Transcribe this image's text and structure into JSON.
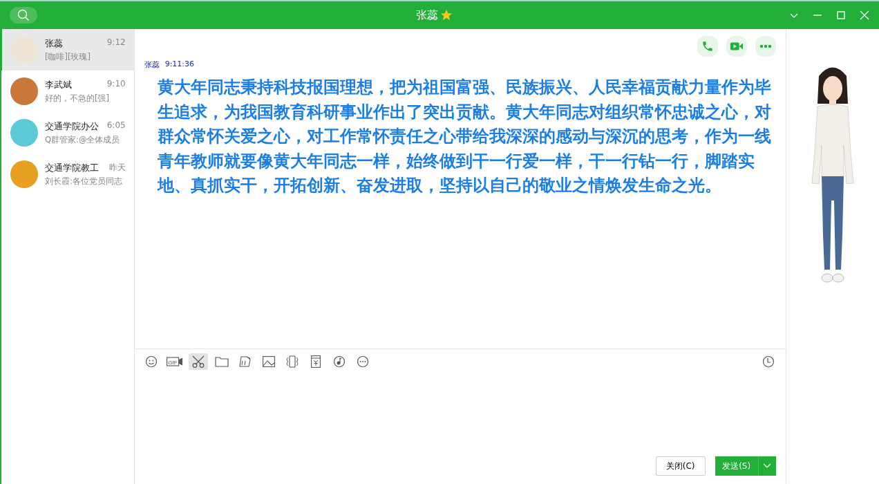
{
  "window": {
    "title": "张蕊"
  },
  "conversations": [
    {
      "name": "张蕊",
      "time": "9:12",
      "preview": "[咖啡][玫瑰]",
      "selected": true,
      "color": "#efe6d6"
    },
    {
      "name": "李武斌",
      "time": "9:10",
      "preview": "好的，不急的[强]",
      "selected": false,
      "color": "#c9773a"
    },
    {
      "name": "交通学院办公",
      "time": "6:05",
      "preview": "Q群管家:@全体成员",
      "selected": false,
      "color": "#5cc9d6"
    },
    {
      "name": "交通学院教工",
      "time": "昨天",
      "preview": "刘长霞:各位党员同志",
      "selected": false,
      "color": "#e8a020"
    }
  ],
  "message": {
    "sender": "张蕊",
    "time": "9:11:36",
    "text": "黄大年同志秉持科技报国理想，把为祖国富强、民族振兴、人民幸福贡献力量作为毕生追求，为我国教育科研事业作出了突出贡献。黄大年同志对组织常怀忠诚之心，对群众常怀关爱之心，对工作常怀责任之心带给我深深的感动与深沉的思考，作为一线青年教师就要像黄大年同志一样，始终做到干一行爱一样，干一行钻一行，脚踏实地、真抓实干，开拓创新、奋发进取，坚持以自己的敬业之情焕发生命之光。"
  },
  "toolbar": [
    {
      "kind": "emoji",
      "selected": false
    },
    {
      "kind": "gif",
      "label": "GIF",
      "selected": false
    },
    {
      "kind": "scissors",
      "selected": true
    },
    {
      "kind": "folder",
      "selected": false
    },
    {
      "kind": "doodle",
      "selected": false
    },
    {
      "kind": "image",
      "selected": false
    },
    {
      "kind": "shake",
      "selected": false
    },
    {
      "kind": "redpacket",
      "selected": false
    },
    {
      "kind": "music",
      "selected": false
    },
    {
      "kind": "more",
      "selected": false
    }
  ],
  "buttons": {
    "close": "关闭(C)",
    "send": "发送(S)"
  }
}
